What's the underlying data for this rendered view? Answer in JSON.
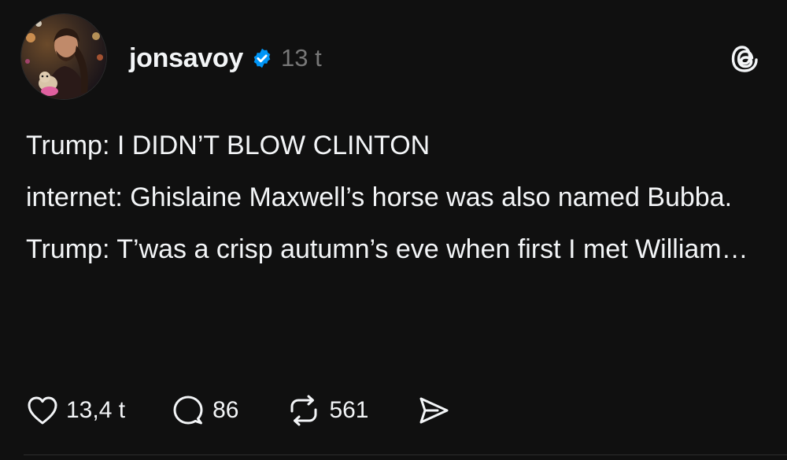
{
  "post": {
    "author": {
      "username": "jonsavoy",
      "verified": true,
      "avatar_icon": "profile-photo"
    },
    "timestamp": "13 t",
    "app_icon": "threads-logo-icon",
    "paragraphs": [
      "Trump: I DIDN’T BLOW CLINTON",
      "internet: Ghislaine Maxwell’s horse was also named Bubba.",
      "Trump: T’was a crisp autumn’s eve when first I met William…"
    ],
    "actions": {
      "like_count": "13,4 t",
      "reply_count": "86",
      "repost_count": "561"
    }
  },
  "colors": {
    "background": "#101010",
    "text": "#f3f5f7",
    "muted": "#777777",
    "verified_blue": "#0095f6"
  }
}
